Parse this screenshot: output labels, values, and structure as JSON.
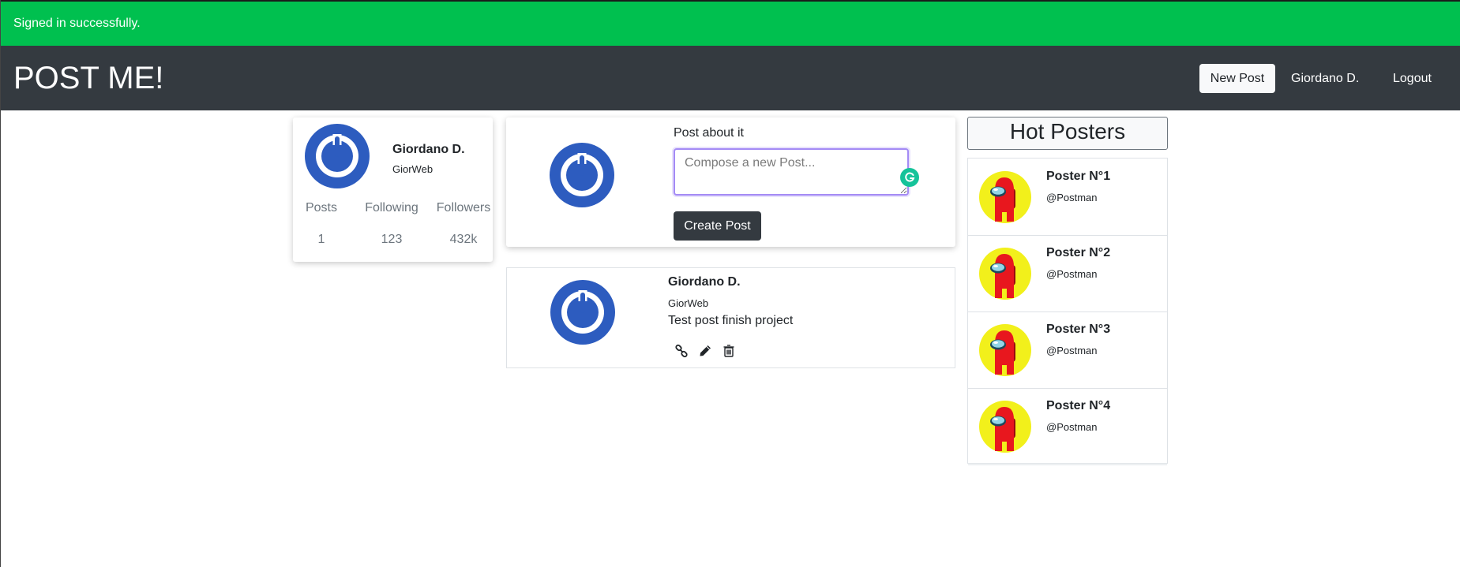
{
  "flash": {
    "message": "Signed in successfully."
  },
  "navbar": {
    "brand": "POST ME!",
    "new_post": "New Post",
    "user": "Giordano D.",
    "logout": "Logout"
  },
  "profile": {
    "name": "Giordano D.",
    "handle": "GiorWeb",
    "stats": [
      {
        "label": "Posts",
        "value": "1"
      },
      {
        "label": "Following",
        "value": "123"
      },
      {
        "label": "Followers",
        "value": "432k"
      }
    ]
  },
  "compose": {
    "label": "Post about it",
    "placeholder": "Compose a new Post...",
    "button": "Create Post"
  },
  "posts": [
    {
      "author": "Giordano D.",
      "handle": "GiorWeb",
      "body": "Test post finish project",
      "actions": [
        "link-icon",
        "pencil-icon",
        "trash-icon"
      ]
    }
  ],
  "hot_posters": {
    "title": "Hot Posters",
    "items": [
      {
        "name": "Poster N°1",
        "handle": "@Postman"
      },
      {
        "name": "Poster N°2",
        "handle": "@Postman"
      },
      {
        "name": "Poster N°3",
        "handle": "@Postman"
      },
      {
        "name": "Poster N°4",
        "handle": "@Postman"
      }
    ]
  },
  "colors": {
    "flash_bg": "#00c04f",
    "navbar_bg": "#343a40",
    "avatar_blue": "#2d5cbf",
    "poster_yellow": "#f2f01b",
    "poster_red": "#e8171e"
  }
}
